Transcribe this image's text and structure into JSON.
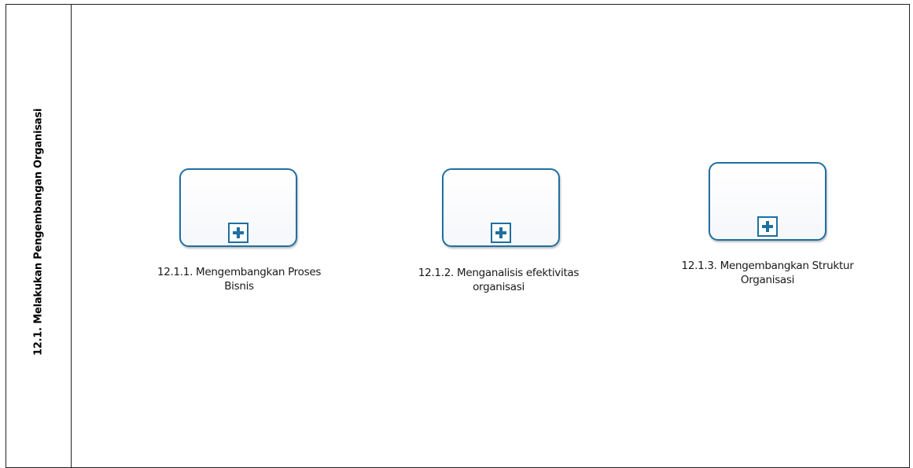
{
  "lane": {
    "title": "12.1. Melakukan Pengembangan Organisasi"
  },
  "tasks": [
    {
      "line1": "12.1.1. Mengembangkan Proses",
      "line2": "Bisnis",
      "marker_icon": "plus-icon"
    },
    {
      "line1": "12.1.2. Menganalisis efektivitas",
      "line2": "organisasi",
      "marker_icon": "plus-icon"
    },
    {
      "line1": "12.1.3. Mengembangkan Struktur",
      "line2": "Organisasi",
      "marker_icon": "plus-icon"
    }
  ],
  "colors": {
    "task_border": "#1f6fa0",
    "marker_plus": "#1f6fa0",
    "lane_border": "#222222"
  }
}
